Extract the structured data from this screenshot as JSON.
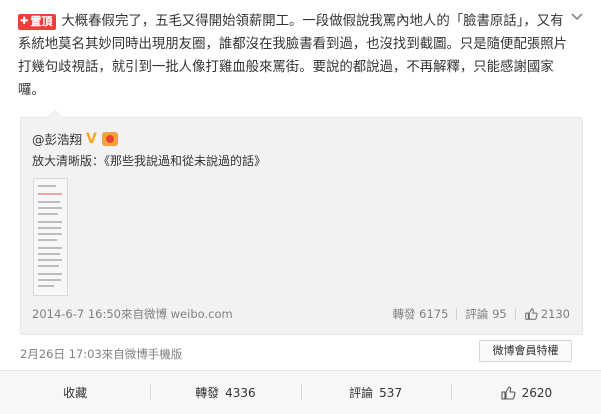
{
  "post": {
    "pin_label": "置頂",
    "text": "大概春假完了，五毛又得開始領薪開工。一段做假說我罵內地人的「臉書原話」，又有系統地莫名其妙同時出現朋友圈，誰都沒在我臉書看到過，也沒找到截圖。只是隨便配張照片打幾句歧視話，就引到一批人像打雞血般來罵街。要說的都說過，不再解釋，只能感謝國家囉。"
  },
  "quote": {
    "author": "@彭浩翔",
    "zoom_label": "放大清晰版：",
    "link_text": "《那些我說過和從未說過的話》",
    "meta": "2014-6-7 16:50來自微博 weibo.com",
    "repost_label": "轉發",
    "repost_count": "6175",
    "comment_label": "評論",
    "comment_count": "95",
    "like_count": "2130"
  },
  "footer": {
    "meta": "2月26日 17:03來自微博手機版",
    "vip_button": "微博會員特權"
  },
  "actions": {
    "favorite_label": "收藏",
    "repost_label": "轉發",
    "repost_count": "4336",
    "comment_label": "評論",
    "comment_count": "537",
    "like_count": "2620"
  },
  "icons": {
    "menu": "chevron-down-icon",
    "verified": "verified-v-icon",
    "medal": "medal-icon",
    "like": "thumb-up-icon"
  },
  "colors": {
    "pin_badge": "#e9413a",
    "verified": "#f5a623",
    "quote_bg": "#f2f2f5",
    "muted": "#808080"
  }
}
